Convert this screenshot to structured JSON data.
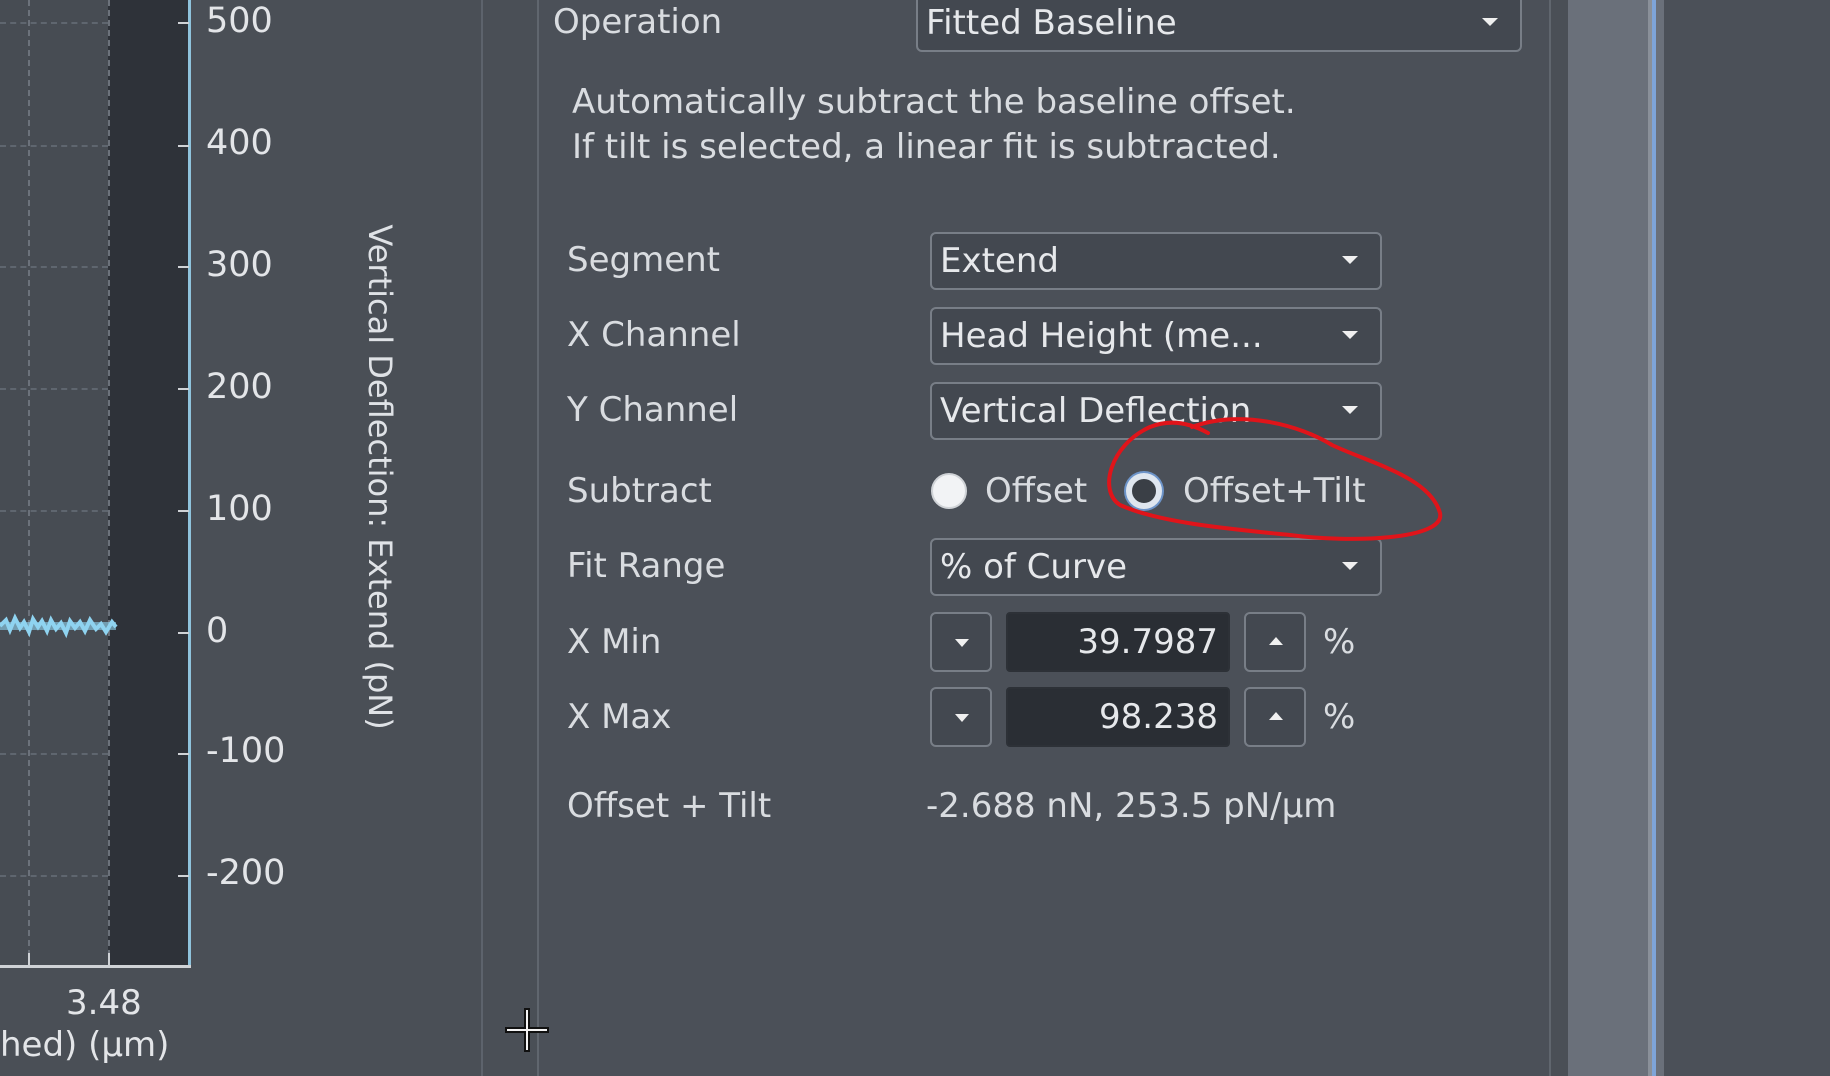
{
  "plot": {
    "y_ticks": [
      "500",
      "400",
      "300",
      "200",
      "100",
      "0",
      "-100",
      "-200"
    ],
    "x_tick": "3.48",
    "x_axis_title_fragment": "hed) (μm)",
    "y_axis_title": "Vertical Deflection: Extend (pN)",
    "trace_color": "#8fd3f0"
  },
  "panel": {
    "operation_label": "Operation",
    "operation_value": "Fitted Baseline",
    "description_line1": "Automatically subtract the baseline offset.",
    "description_line2": "If tilt is selected, a linear fit is subtracted.",
    "segment_label": "Segment",
    "segment_value": "Extend",
    "x_channel_label": "X Channel",
    "x_channel_value": "Head Height (me...",
    "y_channel_label": "Y Channel",
    "y_channel_value": "Vertical Deflection",
    "subtract_label": "Subtract",
    "subtract_options": [
      "Offset",
      "Offset+Tilt"
    ],
    "subtract_selected": "Offset+Tilt",
    "fit_range_label": "Fit Range",
    "fit_range_value": "% of Curve",
    "x_min_label": "X Min",
    "x_min_value": "39.7987",
    "x_min_unit": "%",
    "x_max_label": "X Max",
    "x_max_value": "98.238",
    "x_max_unit": "%",
    "result_label": "Offset + Tilt",
    "result_value": "-2.688 nN, 253.5 pN/μm"
  },
  "annotation_color": "#e0141a"
}
